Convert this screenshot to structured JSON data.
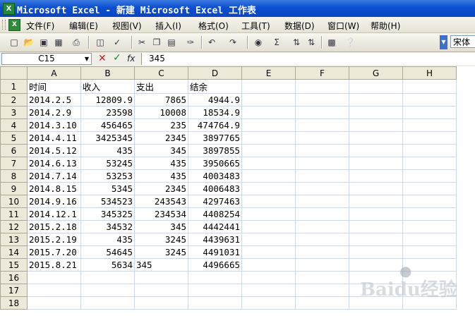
{
  "window": {
    "title": "Microsoft Excel - 新建 Microsoft Excel 工作表",
    "icon": "excel-icon"
  },
  "menu": {
    "items": [
      "文件(F)",
      "编辑(E)",
      "视图(V)",
      "插入(I)",
      "格式(O)",
      "工具(T)",
      "数据(D)",
      "窗口(W)",
      "帮助(H)"
    ]
  },
  "toolbar": {
    "icons": [
      "new-icon",
      "open-icon",
      "save-icon",
      "permission-icon",
      "print-icon",
      "print-preview-icon",
      "spelling-icon",
      "cut-icon",
      "copy-icon",
      "paste-icon",
      "format-painter-icon",
      "undo-icon",
      "redo-icon",
      "hyperlink-icon",
      "autosum-icon",
      "sort-ascending-icon",
      "sort-descending-icon",
      "chart-wizard-icon",
      "help-icon"
    ],
    "font_name": "宋体"
  },
  "formula_bar": {
    "name_box": "C15",
    "fx": "fx",
    "value": "345"
  },
  "columns": [
    "A",
    "B",
    "C",
    "D",
    "E",
    "F",
    "G",
    "H"
  ],
  "rows": [
    {
      "n": "1",
      "cells": [
        "时间",
        "收入",
        "支出",
        "结余",
        "",
        "",
        "",
        ""
      ]
    },
    {
      "n": "2",
      "cells": [
        "2014.2.5",
        "12809.9",
        "7865",
        "4944.9",
        "",
        "",
        "",
        ""
      ]
    },
    {
      "n": "3",
      "cells": [
        "2014.2.9",
        "23598",
        "10008",
        "18534.9",
        "",
        "",
        "",
        ""
      ]
    },
    {
      "n": "4",
      "cells": [
        "2014.3.10",
        "456465",
        "235",
        "474764.9",
        "",
        "",
        "",
        ""
      ]
    },
    {
      "n": "5",
      "cells": [
        "2014.4.11",
        "3425345",
        "2345",
        "3897765",
        "",
        "",
        "",
        ""
      ]
    },
    {
      "n": "6",
      "cells": [
        "2014.5.12",
        "435",
        "345",
        "3897855",
        "",
        "",
        "",
        ""
      ]
    },
    {
      "n": "7",
      "cells": [
        "2014.6.13",
        "53245",
        "435",
        "3950665",
        "",
        "",
        "",
        ""
      ]
    },
    {
      "n": "8",
      "cells": [
        "2014.7.14",
        "53253",
        "435",
        "4003483",
        "",
        "",
        "",
        ""
      ]
    },
    {
      "n": "9",
      "cells": [
        "2014.8.15",
        "5345",
        "2345",
        "4006483",
        "",
        "",
        "",
        ""
      ]
    },
    {
      "n": "10",
      "cells": [
        "2014.9.16",
        "534523",
        "243543",
        "4297463",
        "",
        "",
        "",
        ""
      ]
    },
    {
      "n": "11",
      "cells": [
        "2014.12.1",
        "345325",
        "234534",
        "4408254",
        "",
        "",
        "",
        ""
      ]
    },
    {
      "n": "12",
      "cells": [
        "2015.2.18",
        "34532",
        "345",
        "4442441",
        "",
        "",
        "",
        ""
      ]
    },
    {
      "n": "13",
      "cells": [
        "2015.2.19",
        "435",
        "3245",
        "4439631",
        "",
        "",
        "",
        ""
      ]
    },
    {
      "n": "14",
      "cells": [
        "2015.7.20",
        "54645",
        "3245",
        "4491031",
        "",
        "",
        "",
        ""
      ]
    },
    {
      "n": "15",
      "cells": [
        "2015.8.21",
        "5634",
        "345",
        "4496665",
        "",
        "",
        "",
        ""
      ]
    },
    {
      "n": "16",
      "cells": [
        "",
        "",
        "",
        "",
        "",
        "",
        "",
        ""
      ]
    },
    {
      "n": "17",
      "cells": [
        "",
        "",
        "",
        "",
        "",
        "",
        "",
        ""
      ]
    },
    {
      "n": "18",
      "cells": [
        "",
        "",
        "",
        "",
        "",
        "",
        "",
        ""
      ]
    }
  ],
  "watermark": {
    "text": "Baidu经验"
  }
}
